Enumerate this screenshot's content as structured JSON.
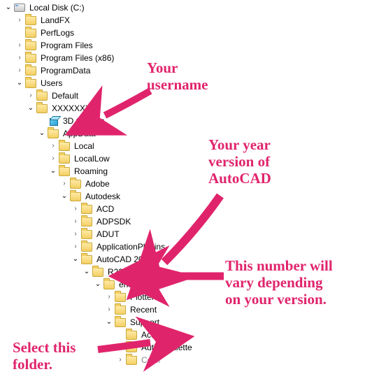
{
  "tree": {
    "root": "Local Disk (C:)",
    "landfx": "LandFX",
    "perflogs": "PerfLogs",
    "programfiles": "Program Files",
    "programfiles86": "Program Files (x86)",
    "programdata": "ProgramData",
    "users": "Users",
    "default": "Default",
    "username": "XXXXXXX",
    "threedobjects": "3D Objects",
    "appdata": "AppData",
    "local": "Local",
    "locallow": "LocalLow",
    "roaming": "Roaming",
    "adobe": "Adobe",
    "autodesk": "Autodesk",
    "acd": "ACD",
    "adpsdk": "ADPSDK",
    "adut": "ADUT",
    "appplugins": "ApplicationPlugins",
    "acadyear": "AutoCAD 2020",
    "rversion": "R23.1",
    "enu": "enu",
    "plotters": "Plotters",
    "recent": "Recent",
    "support": "Support",
    "actions": "Actions",
    "authorpalette": "AuthorPalette",
    "color": "Color"
  },
  "annotations": {
    "username": "Your\nusername",
    "yearversion": "Your year\nversion of\nAutoCAD",
    "number": "This number will\nvary depending\non your version.",
    "select": "Select this\nfolder."
  }
}
